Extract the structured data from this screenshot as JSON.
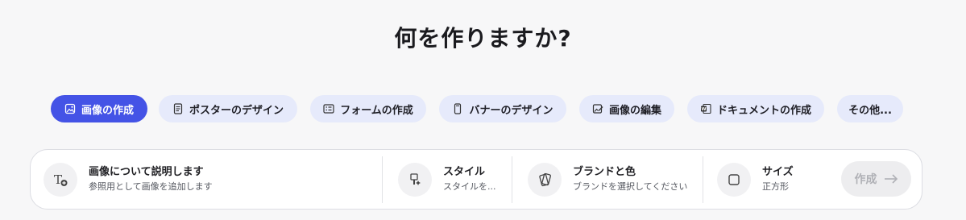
{
  "heading": "何を作りますか?",
  "chips": [
    {
      "label": "画像の作成",
      "icon": "image-icon",
      "active": true
    },
    {
      "label": "ポスターのデザイン",
      "icon": "document-icon",
      "active": false
    },
    {
      "label": "フォームの作成",
      "icon": "form-icon",
      "active": false
    },
    {
      "label": "バナーのデザイン",
      "icon": "phone-banner-icon",
      "active": false
    },
    {
      "label": "画像の編集",
      "icon": "image-edit-icon",
      "active": false
    },
    {
      "label": "ドキュメントの作成",
      "icon": "word-document-icon",
      "active": false
    },
    {
      "label": "その他...",
      "icon": "",
      "active": false
    }
  ],
  "prompt_panel": {
    "describe": {
      "title": "画像について説明します",
      "subtitle": "参照用として画像を追加します",
      "icon": "text-add-icon"
    },
    "style": {
      "title": "スタイル",
      "subtitle": "スタイルを...",
      "icon": "style-brush-icon"
    },
    "brand": {
      "title": "ブランドと色",
      "subtitle": "ブランドを選択してください",
      "icon": "brand-palette-icon"
    },
    "size": {
      "title": "サイズ",
      "subtitle": "正方形",
      "icon": "square-icon"
    },
    "create_button": {
      "label": "作成",
      "icon": "arrow-right-icon"
    }
  },
  "colors": {
    "accent": "#4453e6",
    "chip_bg": "#e6eafb",
    "background": "#f7f7f8"
  }
}
